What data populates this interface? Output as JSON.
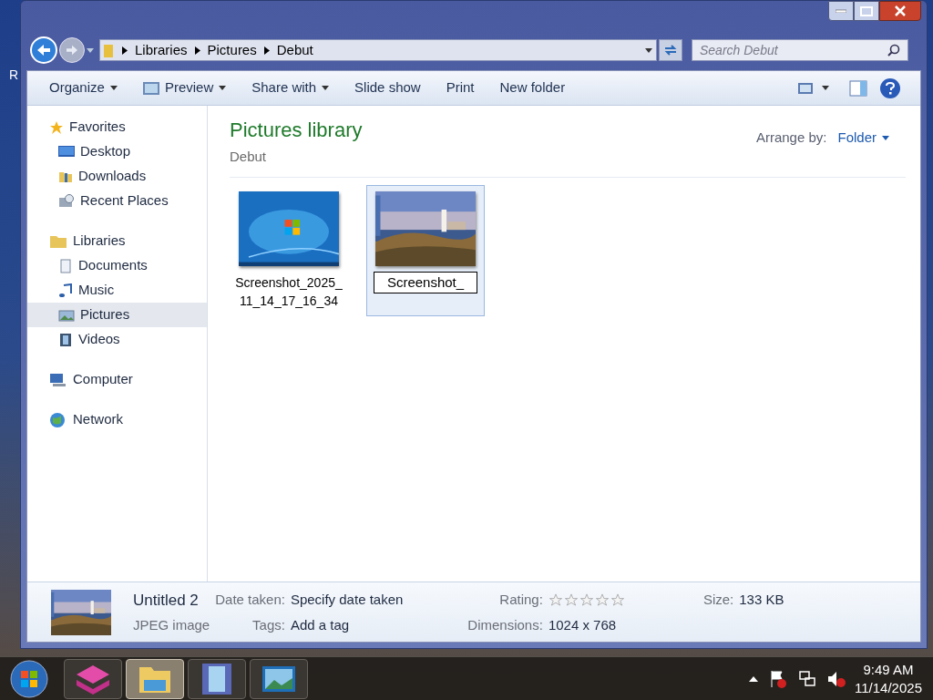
{
  "desktop": {
    "icon_label": "R"
  },
  "address": {
    "crumbs": [
      "Libraries",
      "Pictures",
      "Debut"
    ],
    "search_placeholder": "Search Debut"
  },
  "toolbar": [
    {
      "label": "Organize",
      "dropdown": true
    },
    {
      "label": "Preview",
      "dropdown": true
    },
    {
      "label": "Share with",
      "dropdown": true
    },
    {
      "label": "Slide show",
      "dropdown": false
    },
    {
      "label": "Print",
      "dropdown": false
    },
    {
      "label": "New folder",
      "dropdown": false
    }
  ],
  "sidebar": [
    {
      "label": "Favorites",
      "children": [
        {
          "label": "Desktop",
          "selected": false
        },
        {
          "label": "Downloads",
          "selected": false
        },
        {
          "label": "Recent Places",
          "selected": false
        }
      ]
    },
    {
      "label": "Libraries",
      "children": [
        {
          "label": "Documents",
          "selected": false
        },
        {
          "label": "Music",
          "selected": false
        },
        {
          "label": "Pictures",
          "selected": true
        },
        {
          "label": "Videos",
          "selected": false
        }
      ]
    },
    {
      "label": "Computer"
    },
    {
      "label": "Network"
    }
  ],
  "library": {
    "title": "Pictures library",
    "subtitle": "Debut",
    "arrange_label": "Arrange by:",
    "arrange_value": "Folder"
  },
  "files": [
    {
      "name": "Screenshot_2025_11_14_17_16_34",
      "selected": false,
      "renaming": false
    },
    {
      "name": "Screenshot_",
      "selected": true,
      "renaming": true
    }
  ],
  "details": {
    "name": "Untitled 2",
    "type": "JPEG image",
    "date_label": "Date taken:",
    "date_value": "Specify date taken",
    "tags_label": "Tags:",
    "tags_value": "Add a tag",
    "rating_label": "Rating:",
    "stars": 0,
    "dimensions_label": "Dimensions:",
    "dimensions_value": "1024 x 768",
    "size_label": "Size:",
    "size_value": "133 KB"
  },
  "taskbar": {
    "apps": [
      {
        "selected": false
      },
      {
        "selected": true
      },
      {
        "selected": false
      },
      {
        "selected": false
      }
    ],
    "time": "9:49 AM",
    "date": "11/14/2025"
  }
}
